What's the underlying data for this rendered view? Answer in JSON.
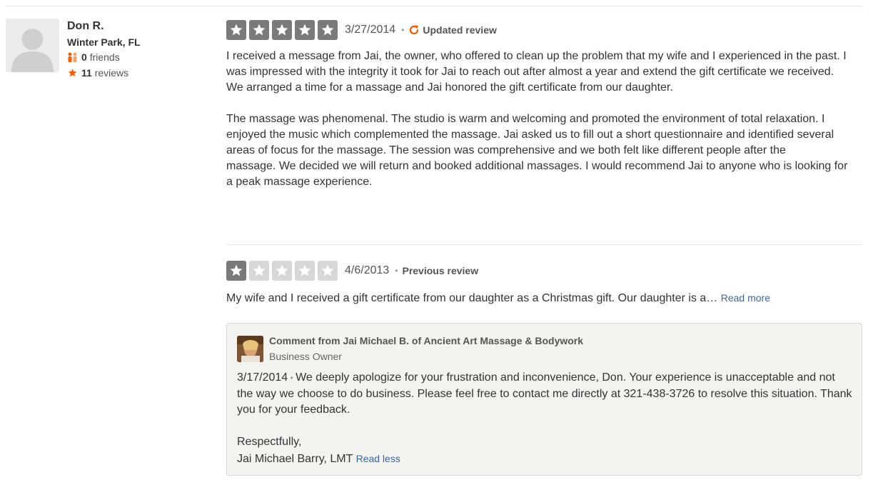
{
  "user": {
    "name": "Don R.",
    "location": "Winter Park, FL",
    "friends_count": "0",
    "friends_label": "friends",
    "reviews_count": "11",
    "reviews_label": "reviews",
    "icons": [
      "avatar-placeholder",
      "friends-icon",
      "star-icon"
    ]
  },
  "updated_review": {
    "rating": 5,
    "date": "3/27/2014",
    "tag": "Updated review",
    "tag_icon": "refresh-icon",
    "text": "I received a message from Jai, the owner, who offered to clean up the problem that my wife and I experienced in the past.  I was impressed with the integrity it took for Jai to reach out after almost a year and extend the gift certificate we received.  We arranged a time for a massage and Jai honored the gift certificate from our daughter.\n\nThe massage was phenomenal.  The studio is warm and welcoming and promoted the environment of total relaxation.  I enjoyed the music which complemented the massage.  Jai asked us to fill out a short questionnaire and identified several areas of focus for the massage.  The session was comprehensive and we both felt like different people after the\nmassage.  We decided we will return and booked additional massages.  I would recommend Jai to anyone who is looking for a peak massage experience."
  },
  "previous_review": {
    "rating": 1,
    "date": "4/6/2013",
    "tag": "Previous review",
    "text": "My wife and I received a gift certificate from our daughter as a Christmas gift.  Our daughter is a…",
    "read_more": "Read more"
  },
  "owner_comment": {
    "title": "Comment from Jai Michael B. of Ancient Art Massage & Bodywork",
    "role": "Business Owner",
    "date": "3/17/2014",
    "text": "We deeply apologize for your frustration and inconvenience, Don. Your experience is unacceptable and not the way we choose to do business. Please feel free to contact me directly at 321-438-3726 to resolve this situation. Thank you for your feedback.\n\nRespectfully,\nJai Michael Barry, LMT",
    "read_less": "Read less"
  },
  "colors": {
    "star_on": "#7a7a7a",
    "star_off": "#d7d7d7",
    "link": "#3b65a7",
    "accent_orange": "#f15c00"
  }
}
